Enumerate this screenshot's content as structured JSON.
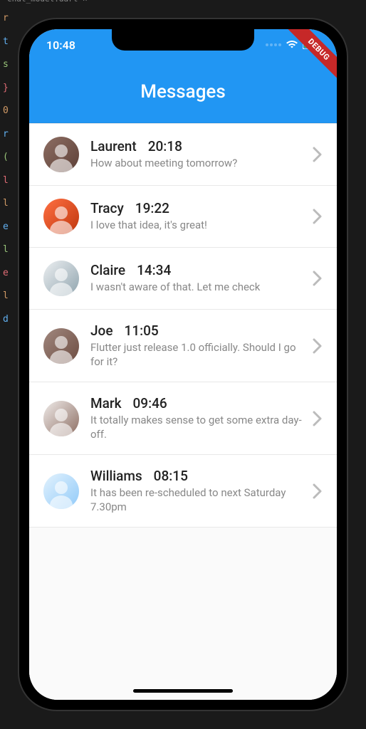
{
  "editor": {
    "tab_label": "chat_model.dart"
  },
  "status": {
    "time": "10:48",
    "debug_label": "DEBUG"
  },
  "appbar": {
    "title": "Messages"
  },
  "chats": [
    {
      "name": "Laurent",
      "time": "20:18",
      "message": "How about meeting tomorrow?",
      "avatar_bg": "linear-gradient(135deg,#8d6e63,#5d4037)"
    },
    {
      "name": "Tracy",
      "time": "19:22",
      "message": "I love that idea, it's great!",
      "avatar_bg": "linear-gradient(135deg,#ff7043,#bf360c)"
    },
    {
      "name": "Claire",
      "time": "14:34",
      "message": "I wasn't aware of that. Let me check",
      "avatar_bg": "linear-gradient(135deg,#eceff1,#90a4ae)"
    },
    {
      "name": "Joe",
      "time": "11:05",
      "message": "Flutter just release 1.0 officially. Should I go for it?",
      "avatar_bg": "linear-gradient(135deg,#a1887f,#6d4c41)"
    },
    {
      "name": "Mark",
      "time": "09:46",
      "message": "It totally makes sense to get some extra day-off.",
      "avatar_bg": "linear-gradient(135deg,#efebe9,#8d6e63)"
    },
    {
      "name": "Williams",
      "time": "08:15",
      "message": "It has been re-scheduled to next Saturday 7.30pm",
      "avatar_bg": "linear-gradient(135deg,#e3f2fd,#90caf9)"
    }
  ]
}
